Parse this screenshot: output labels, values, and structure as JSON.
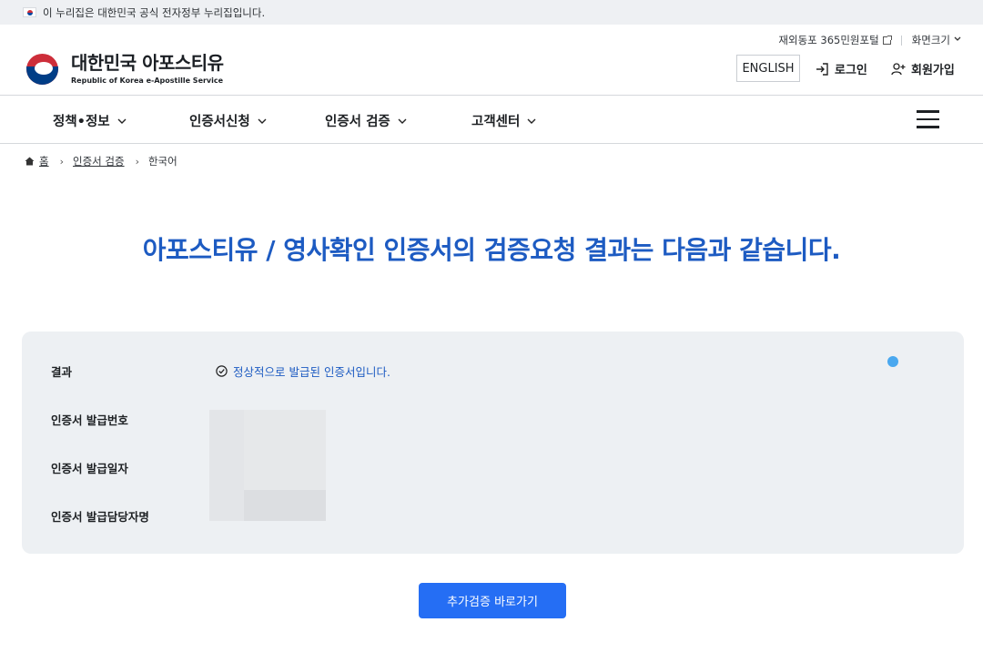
{
  "banner": {
    "text": "이 누리집은 대한민국 공식 전자정부 누리집입니다."
  },
  "util": {
    "portal_label": "재외동포 365민원포털",
    "screen_size_label": "화면크기"
  },
  "logo": {
    "title": "대한민국 아포스티유",
    "subtitle": "Republic of Korea e-Apostille Service"
  },
  "header": {
    "english_label": "ENGLISH",
    "login_label": "로그인",
    "join_label": "회원가입"
  },
  "nav": {
    "items": [
      {
        "label": "정책•정보"
      },
      {
        "label": "인증서신청"
      },
      {
        "label": "인증서 검증"
      },
      {
        "label": "고객센터"
      }
    ]
  },
  "breadcrumb": {
    "home": "홈",
    "parent": "인증서 검증",
    "current": "한국어"
  },
  "page": {
    "heading": "아포스티유 / 영사확인 인증서의 검증요청 결과는 다음과 같습니다."
  },
  "result": {
    "rows": [
      {
        "label": "결과"
      },
      {
        "label": "인증서 발급번호"
      },
      {
        "label": "인증서 발급일자"
      },
      {
        "label": "인증서 발급담당자명"
      }
    ],
    "status_text": "정상적으로 발급된 인증서입니다."
  },
  "actions": {
    "more_verify_label": "추가검증 바로가기"
  },
  "colors": {
    "accent": "#1d5bc2",
    "button": "#256ef4",
    "panel": "#edf0f3",
    "dot": "#4aa8ef"
  }
}
